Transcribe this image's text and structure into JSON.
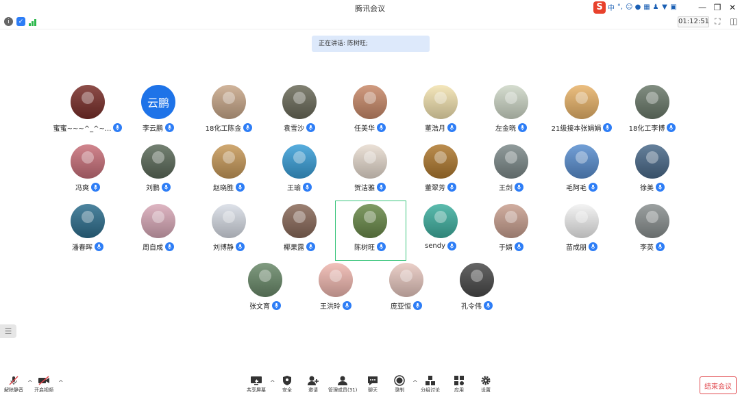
{
  "window": {
    "title": "腾讯会议"
  },
  "ime": {
    "brand": "S",
    "lang": "中",
    "punct": "°,"
  },
  "timer": "01:12:51",
  "speaking": {
    "label": "正在讲话: 陈树旺;"
  },
  "participants": [
    {
      "name": "蜜蜜~~~^_^~...",
      "color": "#7a2f2a"
    },
    {
      "name": "李云鹏",
      "avatar_text": "云鹏",
      "color": "#1e73e8"
    },
    {
      "name": "18化工陈金",
      "color": "#c9a88a"
    },
    {
      "name": "袁雪沙",
      "color": "#6b6b5a"
    },
    {
      "name": "任美华",
      "color": "#c98a6a"
    },
    {
      "name": "董浩月",
      "color": "#f3e3b0"
    },
    {
      "name": "左金晓",
      "color": "#cfd8c8"
    },
    {
      "name": "21级接本张娟娟",
      "color": "#e9b46a"
    },
    {
      "name": "18化工李博",
      "color": "#6b7a6b"
    },
    {
      "name": "冯爽",
      "color": "#c9707a"
    },
    {
      "name": "刘鹏",
      "color": "#5c6b5a"
    },
    {
      "name": "赵晓胜",
      "color": "#c89a5a"
    },
    {
      "name": "王瑜",
      "color": "#3a9fd8"
    },
    {
      "name": "贺洁雅",
      "color": "#e8dcd0"
    },
    {
      "name": "董翠芳",
      "color": "#b07a30"
    },
    {
      "name": "王剑",
      "color": "#7d8a8a"
    },
    {
      "name": "毛阿毛",
      "color": "#5a8fd0"
    },
    {
      "name": "徐美",
      "color": "#4a6a8a"
    },
    {
      "name": "潘春晖",
      "color": "#2e6f8e"
    },
    {
      "name": "周自成",
      "color": "#d9a9b8"
    },
    {
      "name": "刘博静",
      "color": "#d8dde6"
    },
    {
      "name": "椰果露",
      "color": "#8a6a5a"
    },
    {
      "name": "陈树旺",
      "color": "#6a8a4a"
    },
    {
      "name": "sendy",
      "color": "#3fb0a0"
    },
    {
      "name": "于婧",
      "color": "#c9a090"
    },
    {
      "name": "苗成朋",
      "color": "#f2f2f2"
    },
    {
      "name": "李英",
      "color": "#8a9090"
    },
    {
      "name": "张文育",
      "color": "#6a8a6a"
    },
    {
      "name": "王洪玲",
      "color": "#f0b8b0"
    },
    {
      "name": "庞亚恒",
      "color": "#e8c8c0"
    },
    {
      "name": "孔令伟",
      "color": "#4a4a4a"
    }
  ],
  "bottom": {
    "unmute": "解除静音",
    "video": "开启视频",
    "share": "共享屏幕",
    "security": "安全",
    "invite": "邀请",
    "members": "管理成员(31)",
    "chat": "聊天",
    "record": "录制",
    "breakout": "分组讨论",
    "apps": "应用",
    "settings": "设置",
    "end": "结束会议"
  }
}
